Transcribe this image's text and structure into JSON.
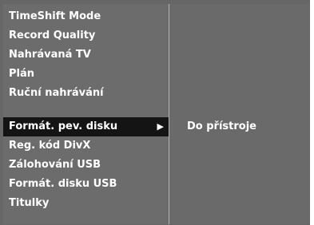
{
  "menu": {
    "items": [
      {
        "label": "TimeShift Mode"
      },
      {
        "label": "Record Quality"
      },
      {
        "label": "Nahrávaná TV"
      },
      {
        "label": "Plán"
      },
      {
        "label": "Ruční nahrávání"
      },
      {
        "label": "Formát. pev. disku",
        "selected": true,
        "has_submenu": true
      },
      {
        "label": "Reg. kód DivX"
      },
      {
        "label": "Zálohování USB"
      },
      {
        "label": "Formát. disku USB"
      },
      {
        "label": "Titulky"
      }
    ],
    "selected_arrow": "▶"
  },
  "submenu": {
    "items": [
      {
        "label": "Do přístroje"
      }
    ]
  }
}
